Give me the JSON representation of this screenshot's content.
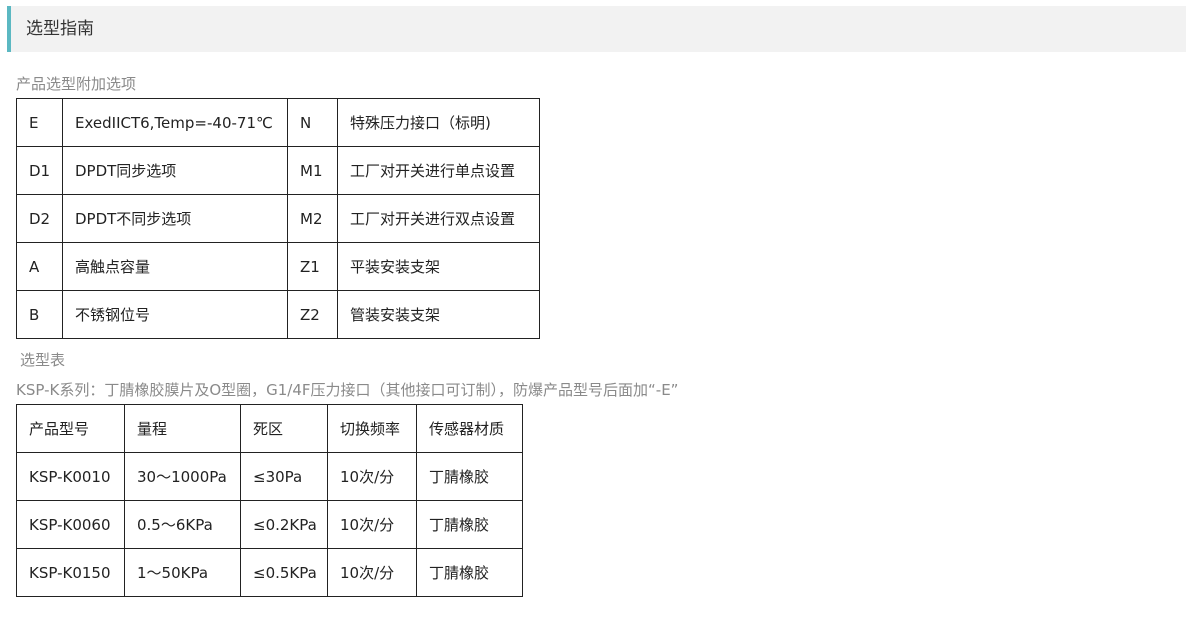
{
  "header": {
    "title": "选型指南"
  },
  "options_section": {
    "label": "产品选型附加选项",
    "rows": [
      [
        "E",
        "ExedIICT6,Temp=-40-71℃",
        "N",
        "特殊压力接口（标明)"
      ],
      [
        "D1",
        "DPDT同步选项",
        "M1",
        "工厂对开关进行单点设置"
      ],
      [
        "D2",
        "DPDT不同步选项",
        "M2",
        "工厂对开关进行双点设置"
      ],
      [
        "A",
        "高触点容量",
        "Z1",
        "平装安装支架"
      ],
      [
        "B",
        "不锈钢位号",
        "Z2",
        "管装安装支架"
      ]
    ]
  },
  "selection_section": {
    "label": "选型表",
    "series_note": "KSP-K系列：丁腈橡胶膜片及O型圈，G1/4F压力接口（其他接口可订制），防爆产品型号后面加“-E”",
    "headers": [
      "产品型号",
      "量程",
      "死区",
      "切换频率",
      "传感器材质"
    ],
    "rows": [
      [
        "KSP-K0010",
        "30～1000Pa",
        "≤30Pa",
        "10次/分",
        "丁腈橡胶"
      ],
      [
        "KSP-K0060",
        "0.5～6KPa",
        "≤0.2KPa",
        "10次/分",
        "丁腈橡胶"
      ],
      [
        "KSP-K0150",
        "1～50KPa",
        "≤0.5KPa",
        "10次/分",
        "丁腈橡胶"
      ]
    ]
  },
  "colors": {
    "accent": "#5bb8c2",
    "header_bg": "#f2f2f2",
    "label_text": "#8a8a8a",
    "border": "#222222"
  }
}
